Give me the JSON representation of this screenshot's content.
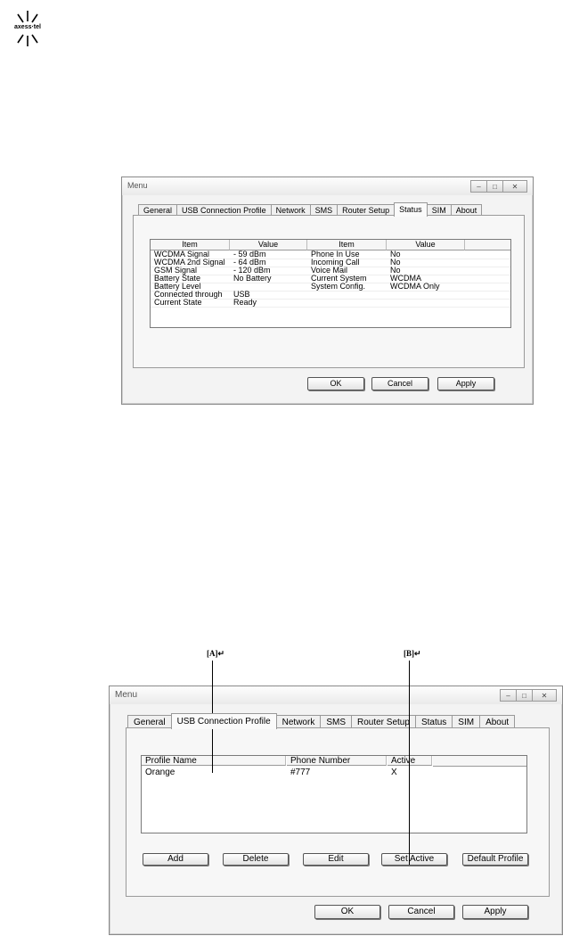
{
  "logo": {
    "text": "axess·tel"
  },
  "status_window": {
    "title": "Menu",
    "tabs": [
      "General",
      "USB Connection Profile",
      "Network",
      "SMS",
      "Router Setup",
      "Status",
      "SIM",
      "About"
    ],
    "active_tab": "Status",
    "columns": [
      "Item",
      "Value",
      "Item",
      "Value"
    ],
    "rows": [
      [
        "WCDMA Signal",
        "- 59 dBm",
        "Phone In Use",
        "No"
      ],
      [
        "WCDMA 2nd Signal",
        "- 64 dBm",
        "Incoming Call",
        "No"
      ],
      [
        "GSM Signal",
        "- 120 dBm",
        "Voice Mail",
        "No"
      ],
      [
        "Battery State",
        "No Battery",
        "Current System",
        "WCDMA"
      ],
      [
        "Battery Level",
        "",
        "System Config.",
        "WCDMA Only"
      ],
      [
        "Connected through",
        "USB",
        "",
        ""
      ],
      [
        "Current State",
        "Ready",
        "",
        ""
      ]
    ],
    "buttons": {
      "ok": "OK",
      "cancel": "Cancel",
      "apply": "Apply"
    }
  },
  "profile_window": {
    "title": "Menu",
    "tabs": [
      "General",
      "USB Connection Profile",
      "Network",
      "SMS",
      "Router Setup",
      "Status",
      "SIM",
      "About"
    ],
    "active_tab": "USB Connection Profile",
    "columns": [
      "Profile Name",
      "Phone Number",
      "Active"
    ],
    "rows": [
      [
        "Orange",
        "#777",
        "X"
      ]
    ],
    "actions": {
      "add": "Add",
      "delete": "Delete",
      "edit": "Edit",
      "set_active": "Set Active",
      "default_profile": "Default Profile"
    },
    "buttons": {
      "ok": "OK",
      "cancel": "Cancel",
      "apply": "Apply"
    }
  },
  "callouts": {
    "a": "[A]↵",
    "b": "[B]↵"
  }
}
